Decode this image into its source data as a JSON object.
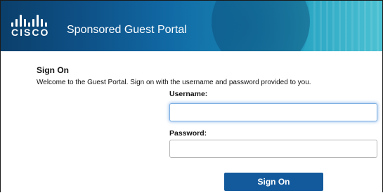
{
  "header": {
    "brand": "CISCO",
    "logo_icon": "cisco-bridge-logo-icon",
    "portal_title": "Sponsored Guest Portal",
    "colors": {
      "banner_dark": "#0b3f6b",
      "banner_light": "#4cc1d2"
    }
  },
  "signon": {
    "heading": "Sign On",
    "welcome": "Welcome to the Guest Portal. Sign on with the username and password provided to you.",
    "username_label": "Username:",
    "username_value": "",
    "password_label": "Password:",
    "password_value": "",
    "button_label": "Sign On",
    "colors": {
      "button": "#135a9c",
      "focus_glow": "#7fb0e3"
    }
  }
}
